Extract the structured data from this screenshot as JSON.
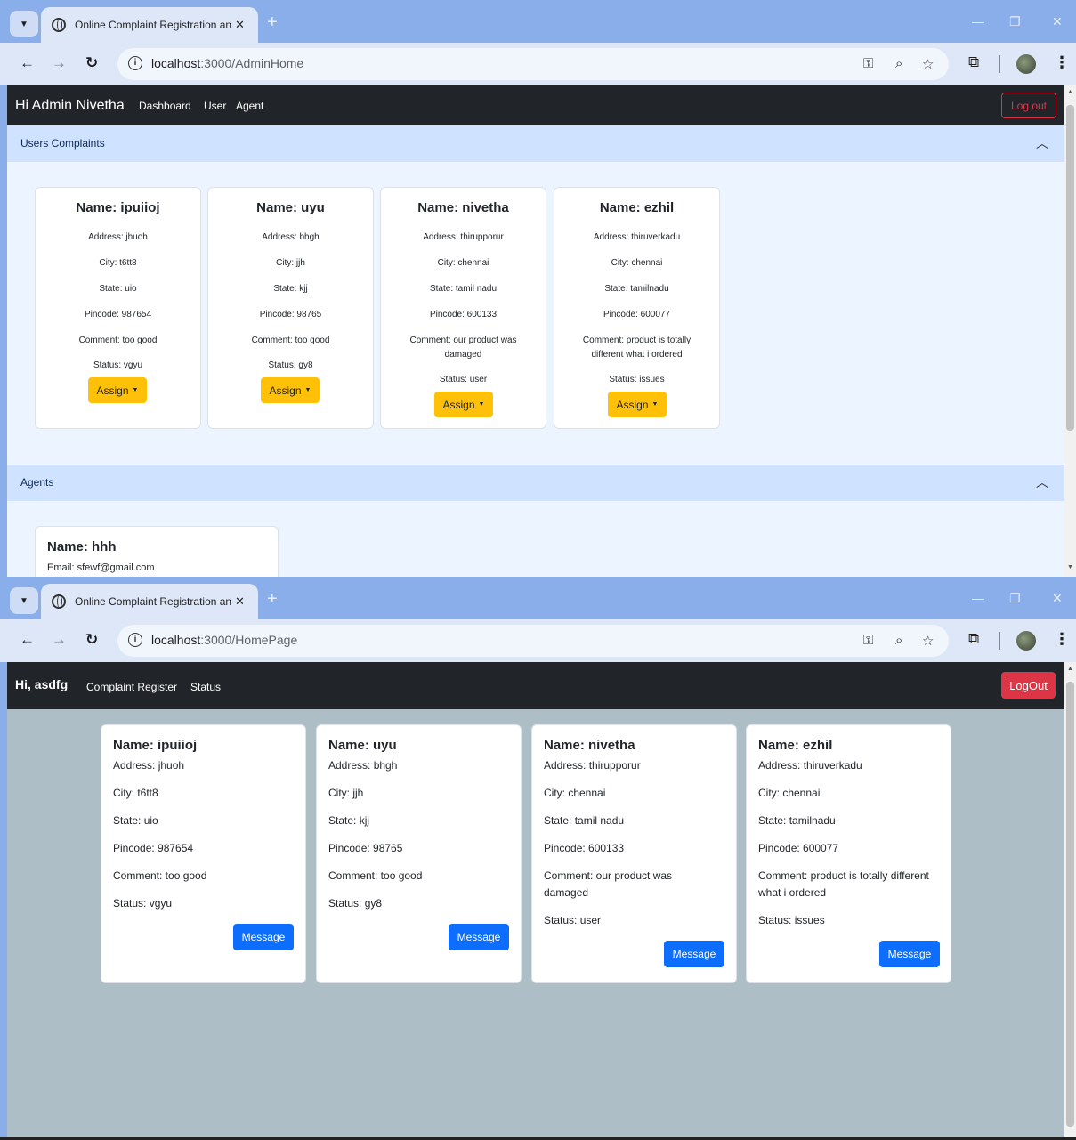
{
  "browser": {
    "tab_title": "Online Complaint Registration and",
    "tab_close": "✕",
    "new_tab": "+",
    "minimize": "—",
    "restore": "❐",
    "close": "✕"
  },
  "admin": {
    "url_host": "localhost",
    "url_path": ":3000/AdminHome",
    "brand": "Hi Admin Nivetha",
    "nav": [
      "Dashboard",
      "User",
      "Agent"
    ],
    "logout": "Log out",
    "complaints_header": "Users Complaints",
    "agents_header": "Agents",
    "assign_label": "Assign",
    "complaints": [
      {
        "name": "Name: ipuiioj",
        "address": "Address: jhuoh",
        "city": "City: t6tt8",
        "state": "State: uio",
        "pincode": "Pincode: 987654",
        "comment": "Comment: too good",
        "status": "Status: vgyu"
      },
      {
        "name": "Name: uyu",
        "address": "Address: bhgh",
        "city": "City: jjh",
        "state": "State: kjj",
        "pincode": "Pincode: 98765",
        "comment": "Comment: too good",
        "status": "Status: gy8"
      },
      {
        "name": "Name: nivetha",
        "address": "Address: thirupporur",
        "city": "City: chennai",
        "state": "State: tamil nadu",
        "pincode": "Pincode: 600133",
        "comment": "Comment: our product was damaged",
        "status": "Status: user"
      },
      {
        "name": "Name: ezhil",
        "address": "Address: thiruverkadu",
        "city": "City: chennai",
        "state": "State: tamilnadu",
        "pincode": "Pincode: 600077",
        "comment": "Comment: product is totally different what i ordered",
        "status": "Status: issues"
      }
    ],
    "agents": [
      {
        "name": "Name: hhh",
        "email": "Email: sfewf@gmail.com"
      }
    ]
  },
  "user": {
    "url_host": "localhost",
    "url_path": ":3000/HomePage",
    "brand": "Hi, asdfg",
    "nav": [
      "Complaint Register",
      "Status"
    ],
    "logout": "LogOut",
    "message_label": "Message",
    "complaints": [
      {
        "name": "Name: ipuiioj",
        "address": "Address: jhuoh",
        "city": "City: t6tt8",
        "state": "State: uio",
        "pincode": "Pincode: 987654",
        "comment": "Comment: too good",
        "status": "Status: vgyu"
      },
      {
        "name": "Name: uyu",
        "address": "Address: bhgh",
        "city": "City: jjh",
        "state": "State: kjj",
        "pincode": "Pincode: 98765",
        "comment": "Comment: too good",
        "status": "Status: gy8"
      },
      {
        "name": "Name: nivetha",
        "address": "Address: thirupporur",
        "city": "City: chennai",
        "state": "State: tamil nadu",
        "pincode": "Pincode: 600133",
        "comment": "Comment: our product was damaged",
        "status": "Status: user"
      },
      {
        "name": "Name: ezhil",
        "address": "Address: thiruverkadu",
        "city": "City: chennai",
        "state": "State: tamilnadu",
        "pincode": "Pincode: 600077",
        "comment": "Comment: product is totally different what i ordered",
        "status": "Status: issues"
      }
    ]
  }
}
